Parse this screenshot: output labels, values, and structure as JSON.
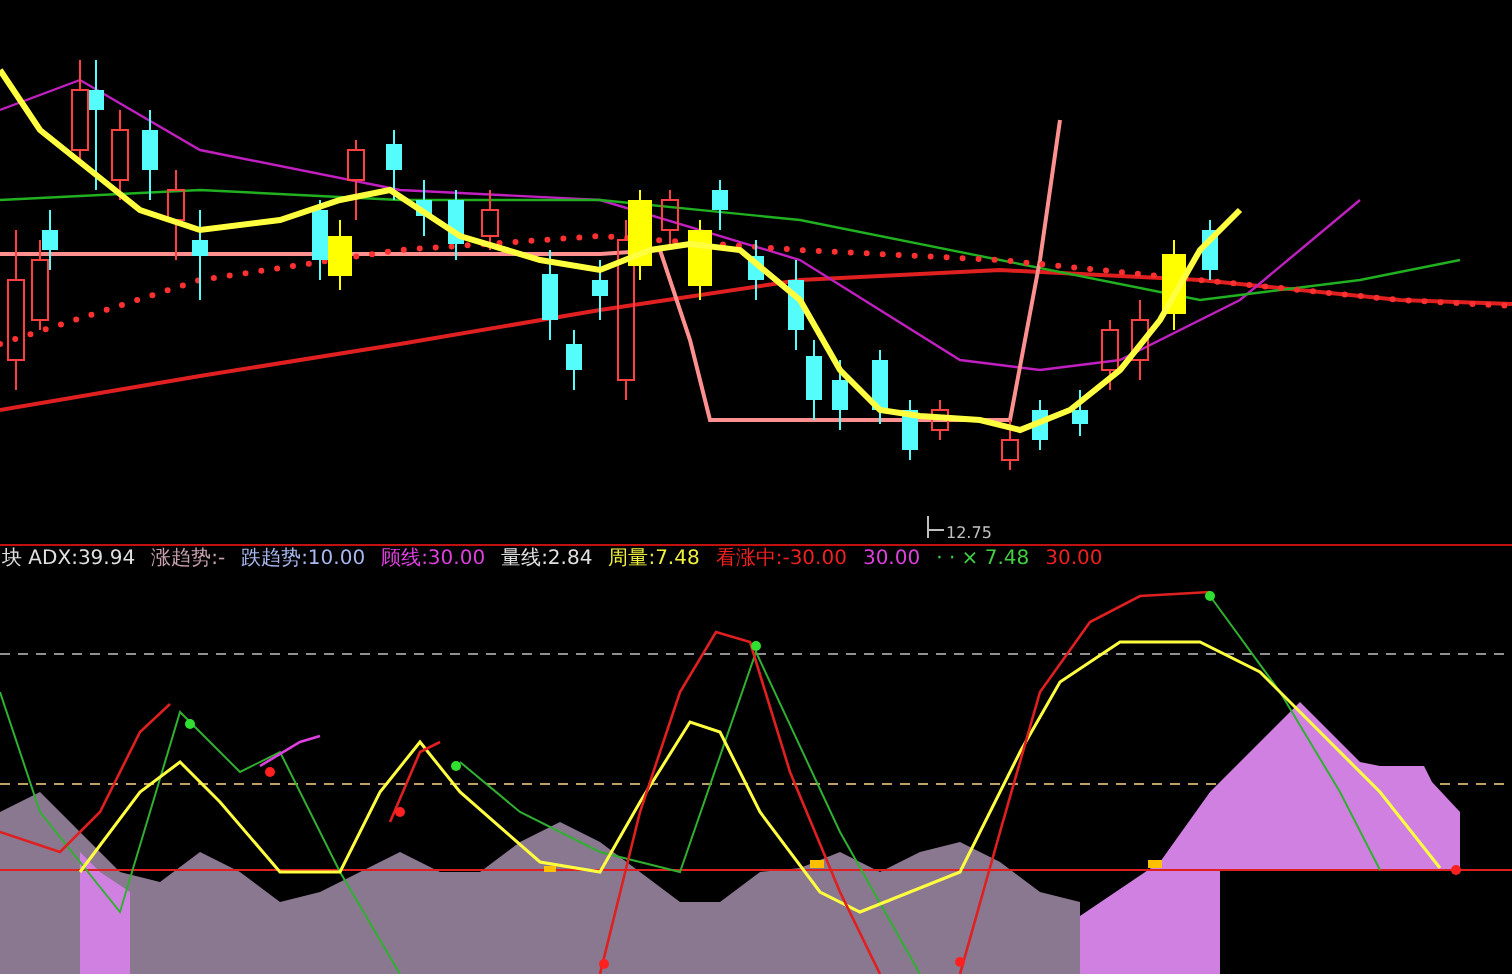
{
  "price_chart": {
    "low_label": "12.75"
  },
  "indicator_legend": [
    {
      "text": "块 ADX:39.94",
      "color": "#e0e0e0"
    },
    {
      "text": "涨趋势:-",
      "color": "#c8a0b0"
    },
    {
      "text": "跌趋势:10.00",
      "color": "#a8b8f0"
    },
    {
      "text": "顾线:30.00",
      "color": "#e040e0"
    },
    {
      "text": "量线:2.84",
      "color": "#e0e0e0"
    },
    {
      "text": "周量:7.48",
      "color": "#f0f040"
    },
    {
      "text": "看涨中:-30.00",
      "color": "#f02020"
    },
    {
      "text": "30.00",
      "color": "#e040e0"
    },
    {
      "text": "· · × 7.48",
      "color": "#40d040"
    },
    {
      "text": "30.00",
      "color": "#f02020"
    }
  ]
}
